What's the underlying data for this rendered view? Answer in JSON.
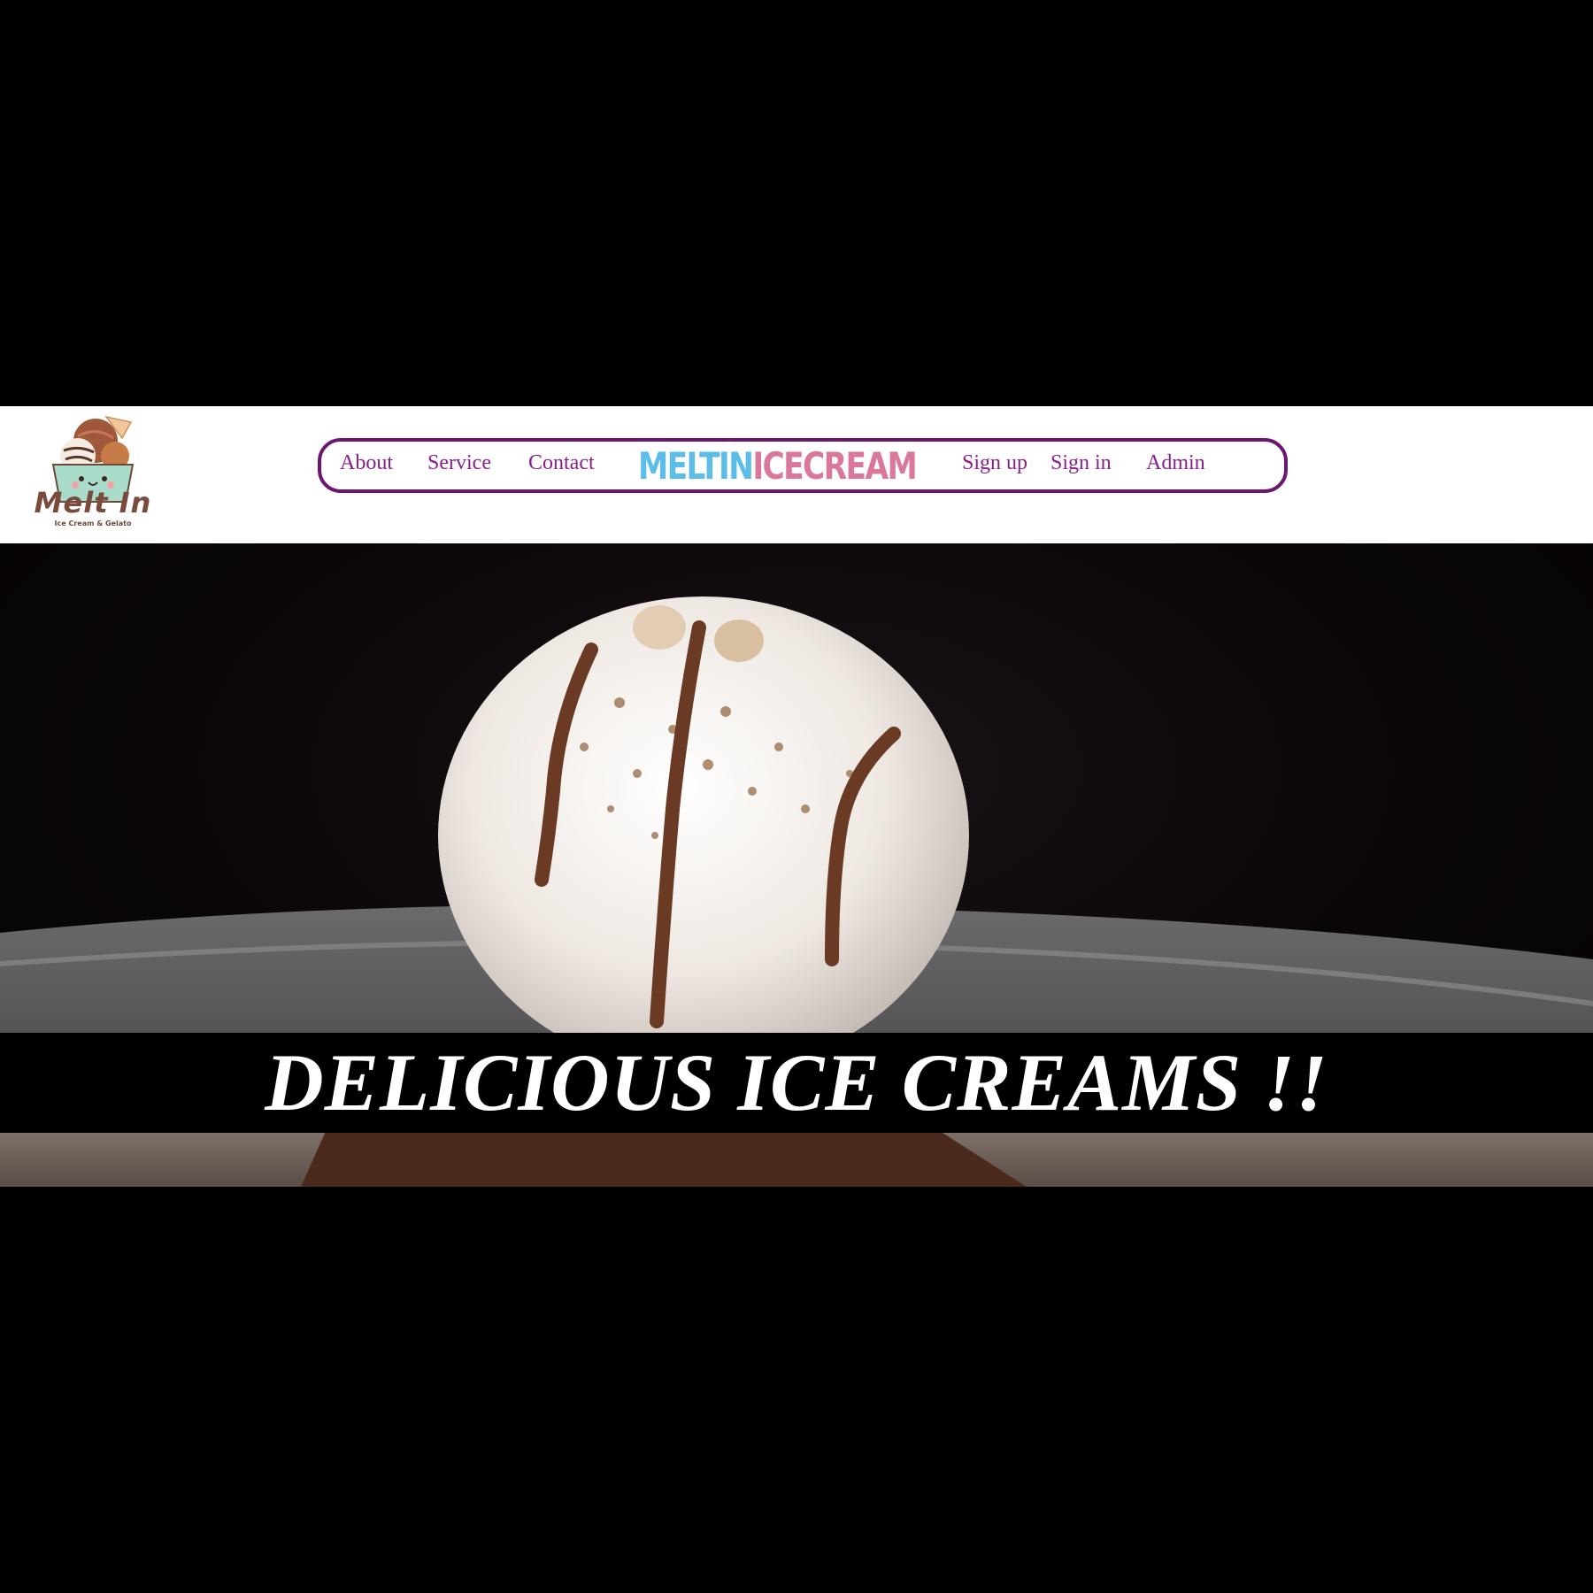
{
  "header": {
    "logo": {
      "name": "Melt In",
      "tagline": "Ice Cream & Gelato"
    },
    "nav_left": [
      {
        "label": "About"
      },
      {
        "label": "Service"
      },
      {
        "label": "Contact"
      }
    ],
    "brand": {
      "part1": "MELTIN",
      "part2": "ICECREAM",
      "color1": "#5bbde8",
      "color2": "#d9789c"
    },
    "nav_right": [
      {
        "label": "Sign up"
      },
      {
        "label": "Sign in"
      },
      {
        "label": "Admin"
      }
    ],
    "nav_border_color": "#6b1670",
    "link_color": "#8a1e8c"
  },
  "hero": {
    "headline": "DELICIOUS ICE CREAMS !!"
  }
}
